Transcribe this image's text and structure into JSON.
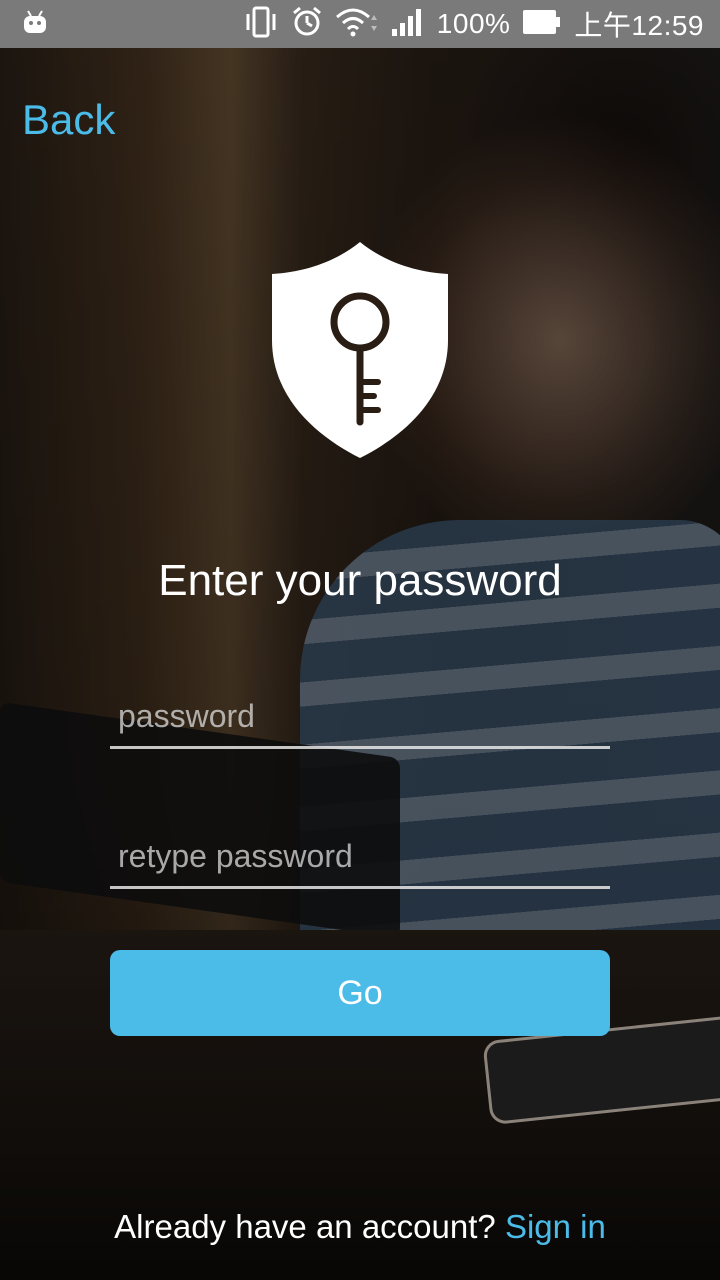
{
  "status_bar": {
    "battery_text": "100%",
    "time_text": "上午12:59",
    "icons": [
      "android-icon",
      "vibrate-icon",
      "alarm-icon",
      "wifi-icon",
      "signal-icon",
      "battery-icon"
    ]
  },
  "nav": {
    "back_label": "Back"
  },
  "logo": {
    "icon": "shield-key-icon"
  },
  "title": "Enter your password",
  "form": {
    "password_placeholder": "password",
    "password_value": "",
    "retype_placeholder": "retype password",
    "retype_value": "",
    "go_label": "Go"
  },
  "footer": {
    "prompt": "Already have an account?",
    "signin_label": "Sign in"
  },
  "colors": {
    "accent": "#4bbbe8",
    "status_bar_bg": "#7a7a7a",
    "text": "#ffffff"
  }
}
